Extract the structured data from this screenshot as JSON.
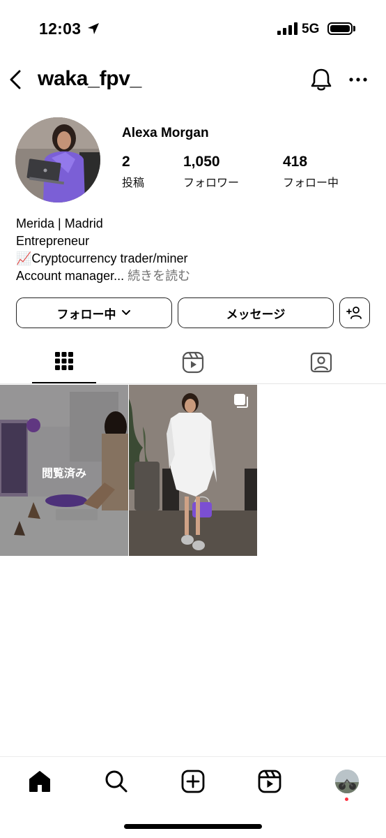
{
  "status_bar": {
    "time": "12:03",
    "network": "5G",
    "icons": [
      "location-arrow-icon",
      "signal-icon",
      "battery-icon"
    ]
  },
  "header": {
    "username": "waka_fpv_",
    "icons": [
      "back-icon",
      "bell-icon",
      "more-icon"
    ]
  },
  "profile": {
    "display_name": "Alexa Morgan",
    "stats": [
      {
        "value": "2",
        "label": "投稿"
      },
      {
        "value": "1,050",
        "label": "フォロワー"
      },
      {
        "value": "418",
        "label": "フォロー中"
      }
    ],
    "bio": {
      "line1": "Merida | Madrid",
      "line2": "Entrepreneur",
      "line3_emoji": "📈",
      "line3": "Cryptocurrency trader/miner",
      "line4": "Account manager...",
      "more": "続きを読む"
    }
  },
  "actions": {
    "following_label": "フォロー中",
    "message_label": "メッセージ",
    "add_icon": "add-person-icon"
  },
  "tabs": [
    {
      "icon": "grid-icon",
      "active": true
    },
    {
      "icon": "reels-icon",
      "active": false
    },
    {
      "icon": "tagged-icon",
      "active": false
    }
  ],
  "posts": [
    {
      "overlay_label": "閲覧済み"
    },
    {
      "icon": "multiple-photos-icon"
    }
  ],
  "bottom_nav": [
    "home-icon",
    "search-icon",
    "create-icon",
    "reels-icon",
    "profile-avatar"
  ],
  "colors": {
    "accent": "#000000",
    "secondary_text": "#737373",
    "notification_dot": "#ff3040"
  }
}
